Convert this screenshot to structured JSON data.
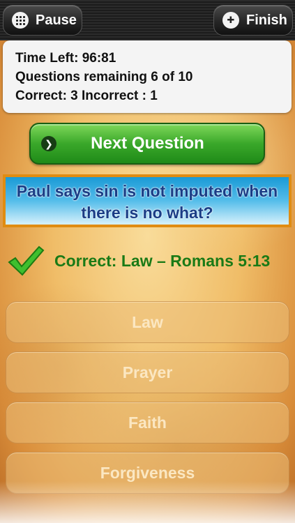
{
  "toolbar": {
    "pause_label": "Pause",
    "finish_label": "Finish",
    "pause_icon": "grid-icon",
    "finish_icon": "plus-icon"
  },
  "stats": {
    "time_left": "Time Left: 96:81",
    "questions_remaining": "Questions remaining 6 of 10",
    "score": "Correct: 3 Incorrect : 1"
  },
  "next_button": {
    "label": "Next Question",
    "icon": "chevron-right-icon",
    "color": "#3aa82a"
  },
  "question": {
    "text": "Paul says sin is not imputed when there is no what?"
  },
  "feedback": {
    "text": "Correct: Law – Romans 5:13",
    "icon": "checkmark-icon",
    "color": "#1a7a16"
  },
  "answers": [
    {
      "label": "Law"
    },
    {
      "label": "Prayer"
    },
    {
      "label": "Faith"
    },
    {
      "label": "Forgiveness"
    }
  ]
}
